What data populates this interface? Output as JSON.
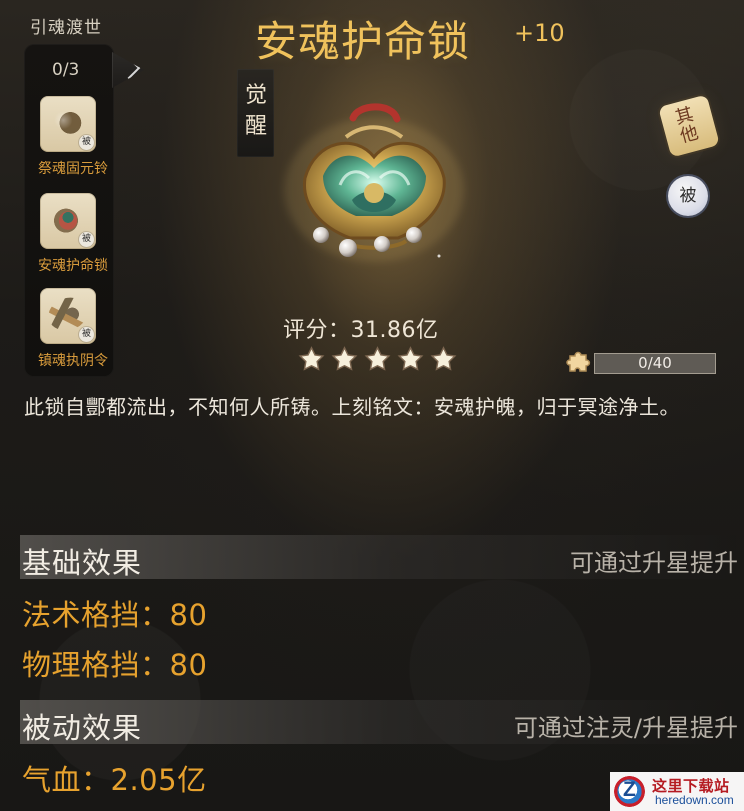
{
  "left_header": "引魂渡世",
  "slot_count": "0/3",
  "linked_items": [
    {
      "name": "祭魂固元铃",
      "passive": "被"
    },
    {
      "name": "安魂护命锁",
      "passive": "被"
    },
    {
      "name": "镇魂执阴令",
      "passive": "被"
    }
  ],
  "title": "安魂护命锁",
  "level": "+10",
  "awaken_label": "觉醒",
  "other_label": "其他",
  "passive_label": "被",
  "score": "评分：31.86亿",
  "star_count": 5,
  "fragment_progress": {
    "text": "0/40",
    "value": 0,
    "max": 40
  },
  "description": "此锁自酆都流出，不知何人所铸。上刻铭文：安魂护魄，归于冥途净土。",
  "base_effect": {
    "title": "基础效果",
    "hint": "可通过升星提升",
    "stats": [
      "法术格挡：80",
      "物理格挡：80"
    ]
  },
  "passive_effect": {
    "title": "被动效果",
    "hint": "可通过注灵/升星提升",
    "stats": [
      "气血：2.05亿"
    ]
  },
  "watermark": {
    "logo_text": "Z",
    "cn": "这里下载站",
    "en": "heredown.com"
  },
  "colors": {
    "gold": "#f0c25c",
    "orange": "#e7a22e",
    "text": "#ece6db",
    "muted": "#b8b2a8"
  }
}
